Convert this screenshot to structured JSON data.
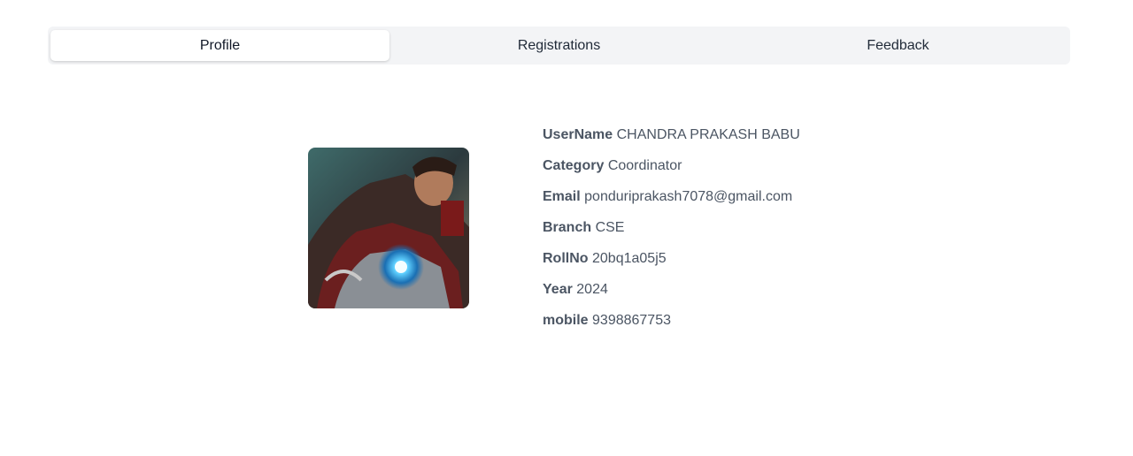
{
  "tabs": [
    {
      "label": "Profile",
      "active": true
    },
    {
      "label": "Registrations",
      "active": false
    },
    {
      "label": "Feedback",
      "active": false
    }
  ],
  "profile": {
    "avatar_icon": "user-avatar-photo",
    "fields": [
      {
        "key": "UserName",
        "value": "CHANDRA PRAKASH BABU"
      },
      {
        "key": "Category",
        "value": "Coordinator"
      },
      {
        "key": "Email",
        "value": "ponduriprakash7078@gmail.com"
      },
      {
        "key": "Branch",
        "value": "CSE"
      },
      {
        "key": "RollNo",
        "value": "20bq1a05j5"
      },
      {
        "key": "Year",
        "value": "2024"
      },
      {
        "key": "mobile",
        "value": "9398867753"
      }
    ]
  },
  "colors": {
    "tab_bar_bg": "#f3f4f6",
    "active_tab_bg": "#ffffff",
    "text": "#4b5563"
  }
}
